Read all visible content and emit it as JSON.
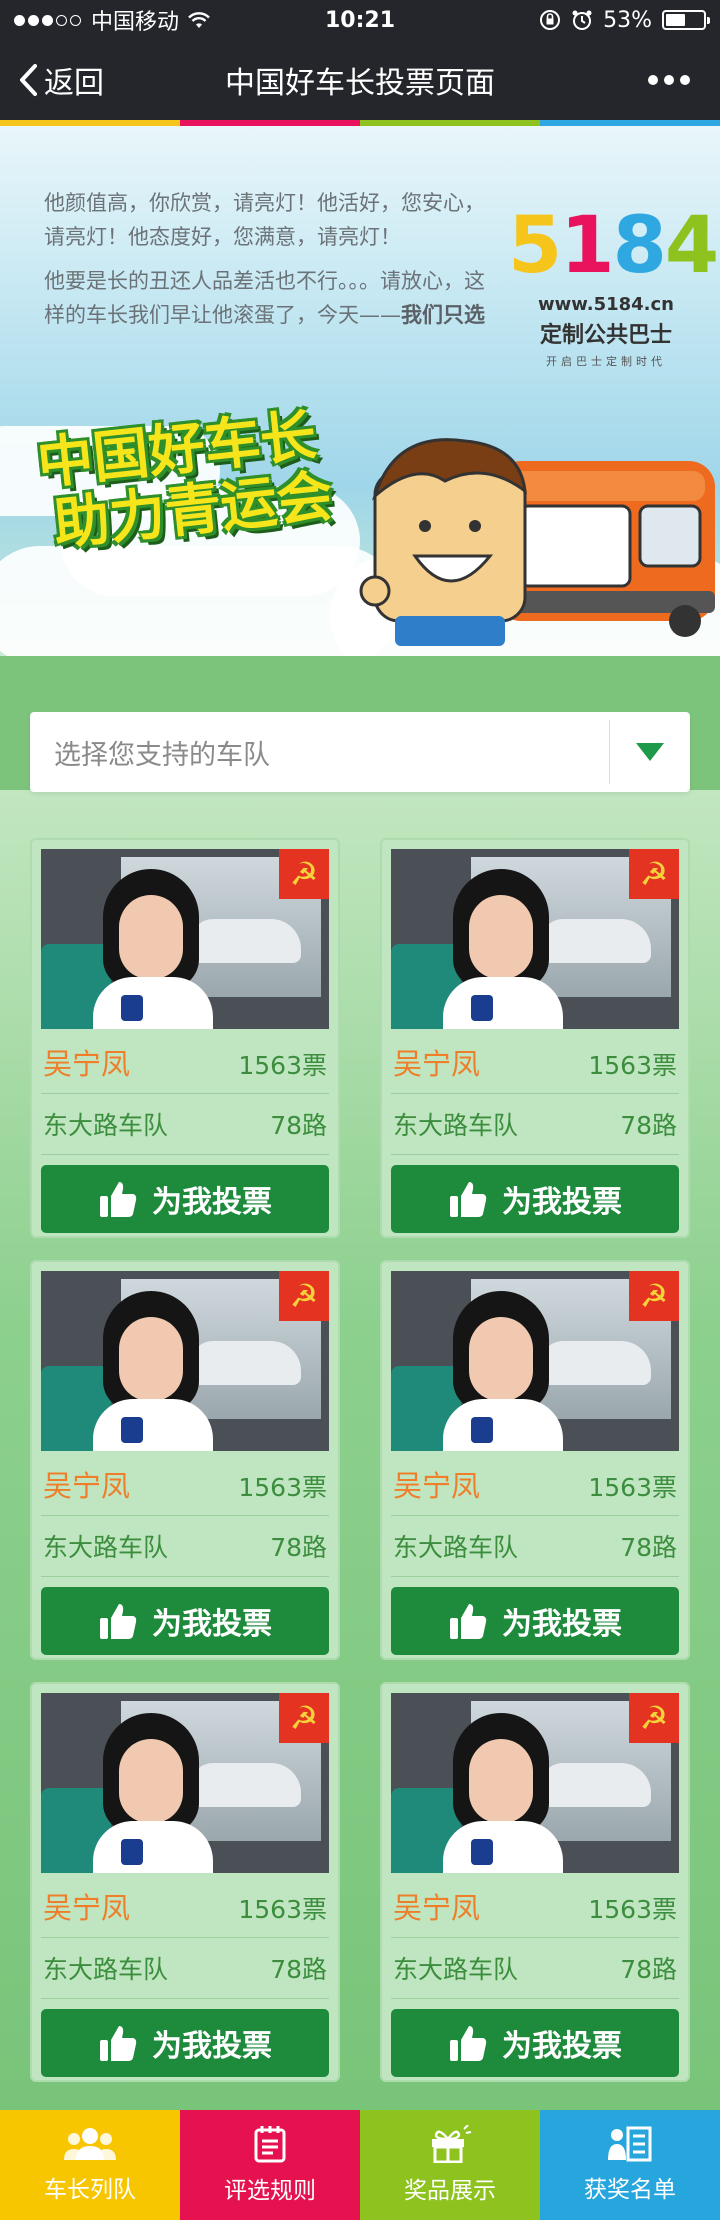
{
  "status_bar": {
    "carrier": "中国移动",
    "time": "10:21",
    "battery": "53%",
    "battery_level": 0.53
  },
  "nav": {
    "back_label": "返回",
    "title": "中国好车长投票页面"
  },
  "rainbow_colors": [
    "#f5c51b",
    "#e9135d",
    "#8dc21f",
    "#2fa7e0"
  ],
  "intro": {
    "line1": "他颜值高，你欣赏，请亮灯！他活好，您安心，请亮灯！他态度好，您满意，请亮灯！",
    "line2_prefix": "他要是长的丑还人品差活也不行。。。请放心，这样的车长我们早让他滚蛋了，今天——",
    "line2_emphasis": "我们只选"
  },
  "brand": {
    "logo": "5184",
    "url": "www.5184.cn",
    "name": "定制公共巴士",
    "slogan": "开启巴士定制时代"
  },
  "campaign": {
    "slogan_line1": "中国好车长",
    "slogan_line2": "助力青运会"
  },
  "selector": {
    "placeholder": "选择您支持的车队",
    "icon": "triangle-down-icon"
  },
  "vote_button_label": "为我投票",
  "drivers": [
    {
      "name": "吴宁凤",
      "votes": "1563票",
      "team": "东大路车队",
      "route": "78路"
    },
    {
      "name": "吴宁凤",
      "votes": "1563票",
      "team": "东大路车队",
      "route": "78路"
    },
    {
      "name": "吴宁凤",
      "votes": "1563票",
      "team": "东大路车队",
      "route": "78路"
    },
    {
      "name": "吴宁凤",
      "votes": "1563票",
      "team": "东大路车队",
      "route": "78路"
    },
    {
      "name": "吴宁凤",
      "votes": "1563票",
      "team": "东大路车队",
      "route": "78路"
    },
    {
      "name": "吴宁凤",
      "votes": "1563票",
      "team": "东大路车队",
      "route": "78路"
    }
  ],
  "tabs": [
    {
      "label": "车长列队",
      "icon": "users-icon",
      "color": "#f7c600"
    },
    {
      "label": "评选规则",
      "icon": "document-icon",
      "color": "#e6114f"
    },
    {
      "label": "奖品展示",
      "icon": "gift-icon",
      "color": "#8dc21f"
    },
    {
      "label": "获奖名单",
      "icon": "list-icon",
      "color": "#27a5dd"
    }
  ]
}
